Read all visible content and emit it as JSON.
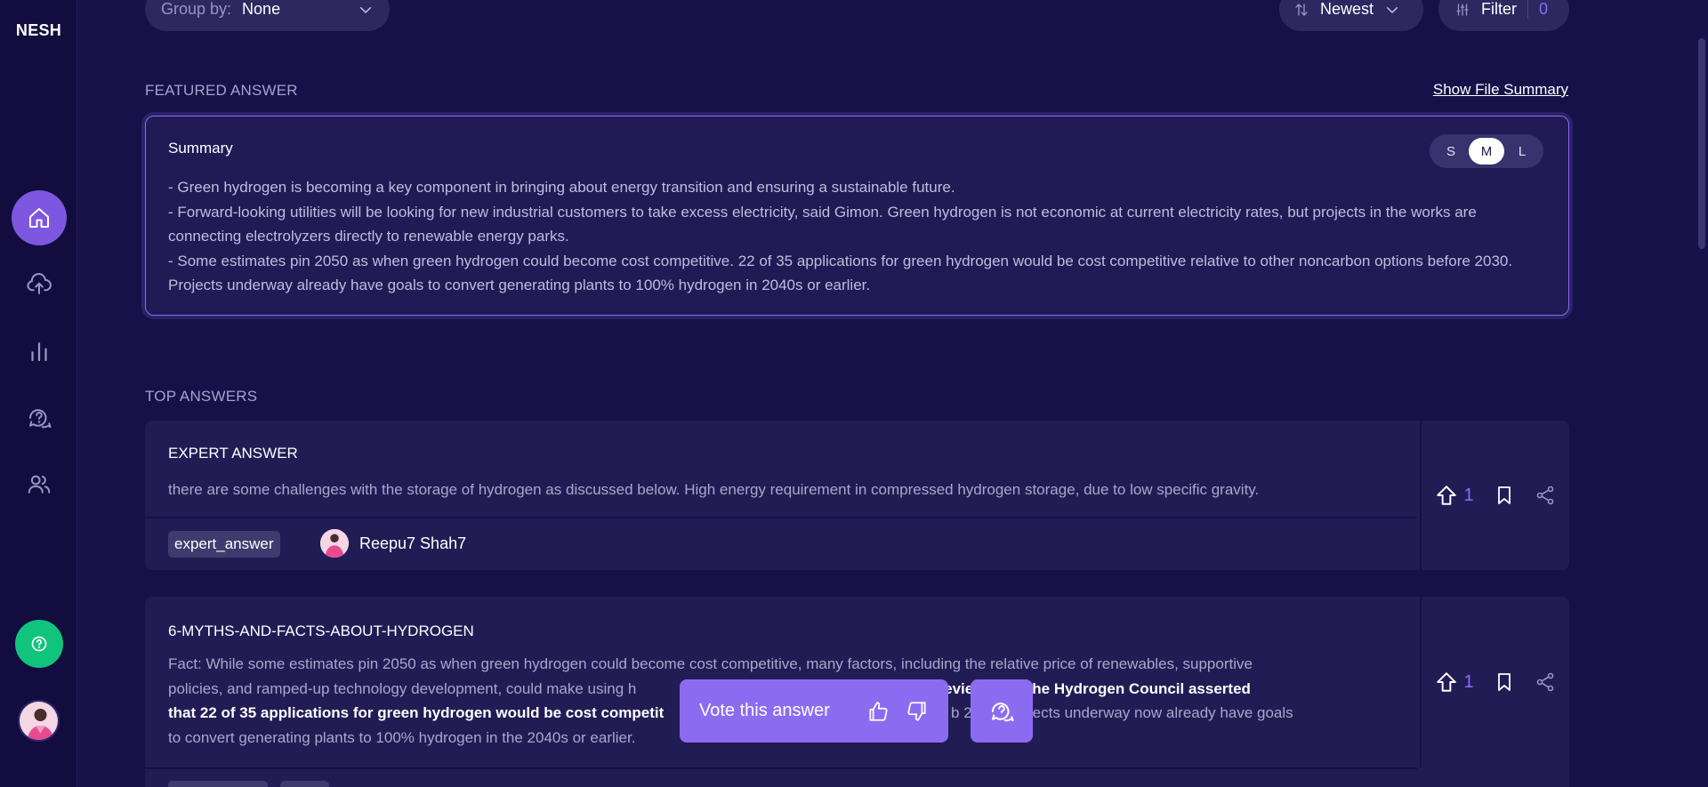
{
  "app": {
    "logo": "NESH"
  },
  "sidebar": {
    "items": [
      {
        "name": "home",
        "icon": "home-icon",
        "active": true
      },
      {
        "name": "upload",
        "icon": "upload-cloud-icon"
      },
      {
        "name": "analytics",
        "icon": "bar-chart-icon"
      },
      {
        "name": "questions",
        "icon": "chat-question-icon"
      },
      {
        "name": "users",
        "icon": "users-icon"
      }
    ],
    "help_icon": "help-circle-icon"
  },
  "toolbar": {
    "group_by_label": "Group by:",
    "group_by_value": "None",
    "sort_value": "Newest",
    "filter_label": "Filter",
    "filter_count": "0"
  },
  "featured": {
    "section_label": "FEATURED ANSWER",
    "show_file_summary": "Show File Summary",
    "title": "Summary",
    "sizes": [
      "S",
      "M",
      "L"
    ],
    "selected_size": "M",
    "lines": [
      "- Green hydrogen is becoming a key component in bringing about energy transition and ensuring a sustainable future.",
      "- Forward-looking utilities will be looking for new industrial customers to take excess electricity, said Gimon. Green hydrogen is not economic at current electricity rates, but projects in the works are connecting electrolyzers directly to renewable energy parks.",
      "- Some estimates pin 2050 as when green hydrogen could become cost competitive. 22 of 35 applications for green hydrogen would be cost competitive relative to other noncarbon options before 2030. Projects underway already have goals to convert generating plants to 100% hydrogen in 2040s or earlier."
    ]
  },
  "top_answers": {
    "section_label": "TOP ANSWERS",
    "answers": [
      {
        "title": "EXPERT ANSWER",
        "text": "there are some challenges with the storage of hydrogen as discussed below. High energy requirement in compressed hydrogen storage, due to low specific gravity.",
        "tag": "expert_answer",
        "author": "Reepu7 Shah7",
        "votes": "1"
      },
      {
        "title": "6-MYTHS-AND-FACTS-ABOUT-HYDROGEN",
        "text_line1": "Fact: While some estimates pin 2050 as when green hydrogen could become cost competitive, many factors, including the relative price of renewables, supportive",
        "text_line2a": "policies, and ramped-up technology development, could make using h",
        "text_line2b": "the",
        "text_line2c_bold": " A review from the Hydrogen Council asserted",
        "text_line3a_bold": "that 22 of 35 applications for green hydrogen would be cost competit",
        "text_line3b": "ns b",
        "text_line3c": "2030. Projects underway now already have goals",
        "text_line4": "to convert generating plants to 100% hydrogen in the 2040s or earlier.",
        "votes": "1"
      }
    ]
  },
  "vote_bar": {
    "label": "Vote this answer"
  }
}
